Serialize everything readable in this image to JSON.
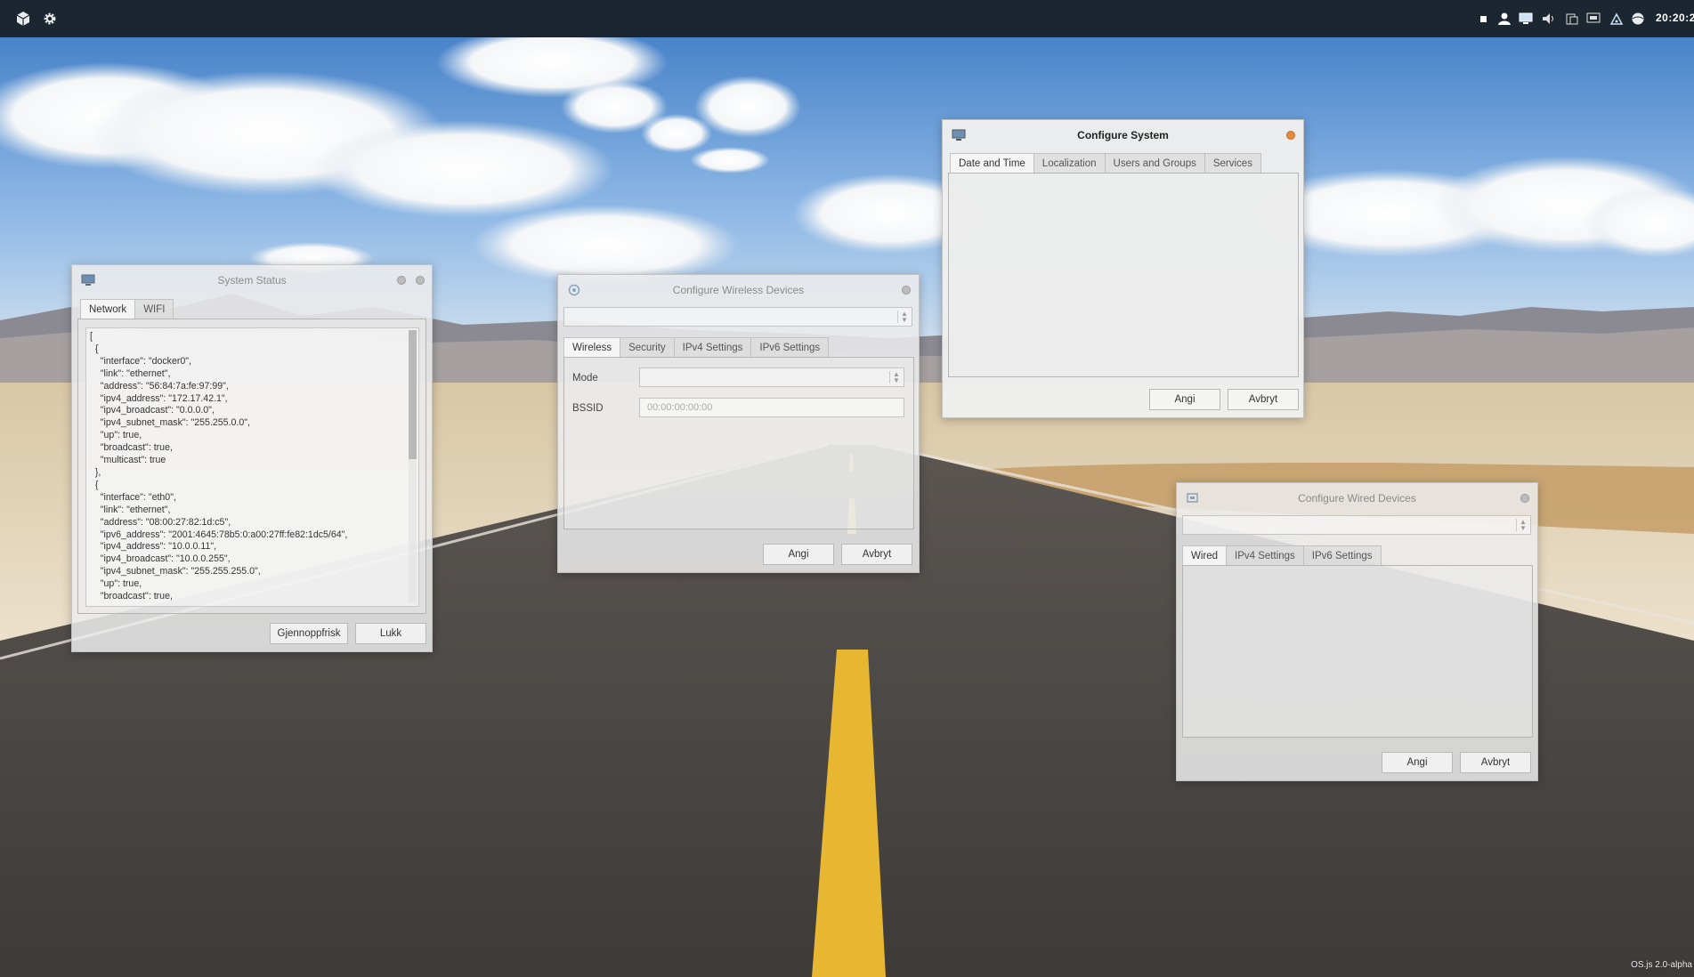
{
  "panel": {
    "clock": "20:20:2"
  },
  "system_status": {
    "title": "System Status",
    "tabs": [
      "Network",
      "WIFI"
    ],
    "json_text": "[\n  {\n    \"interface\": \"docker0\",\n    \"link\": \"ethernet\",\n    \"address\": \"56:84:7a:fe:97:99\",\n    \"ipv4_address\": \"172.17.42.1\",\n    \"ipv4_broadcast\": \"0.0.0.0\",\n    \"ipv4_subnet_mask\": \"255.255.0.0\",\n    \"up\": true,\n    \"broadcast\": true,\n    \"multicast\": true\n  },\n  {\n    \"interface\": \"eth0\",\n    \"link\": \"ethernet\",\n    \"address\": \"08:00:27:82:1d:c5\",\n    \"ipv6_address\": \"2001:4645:78b5:0:a00:27ff:fe82:1dc5/64\",\n    \"ipv4_address\": \"10.0.0.11\",\n    \"ipv4_broadcast\": \"10.0.0.255\",\n    \"ipv4_subnet_mask\": \"255.255.255.0\",\n    \"up\": true,\n    \"broadcast\": true,",
    "refresh_label": "Gjennoppfrisk",
    "close_label": "Lukk"
  },
  "wireless": {
    "title": "Configure Wireless Devices",
    "tabs": [
      "Wireless",
      "Security",
      "IPv4 Settings",
      "IPv6 Settings"
    ],
    "mode_label": "Mode",
    "bssid_label": "BSSID",
    "bssid_placeholder": "00:00:00:00:00",
    "apply_label": "Angi",
    "cancel_label": "Avbryt"
  },
  "system": {
    "title": "Configure System",
    "tabs": [
      "Date and Time",
      "Localization",
      "Users and Groups",
      "Services"
    ],
    "apply_label": "Angi",
    "cancel_label": "Avbryt"
  },
  "wired": {
    "title": "Configure Wired Devices",
    "tabs": [
      "Wired",
      "IPv4 Settings",
      "IPv6 Settings"
    ],
    "apply_label": "Angi",
    "cancel_label": "Avbryt"
  },
  "watermark": "OS.js 2.0-alpha"
}
